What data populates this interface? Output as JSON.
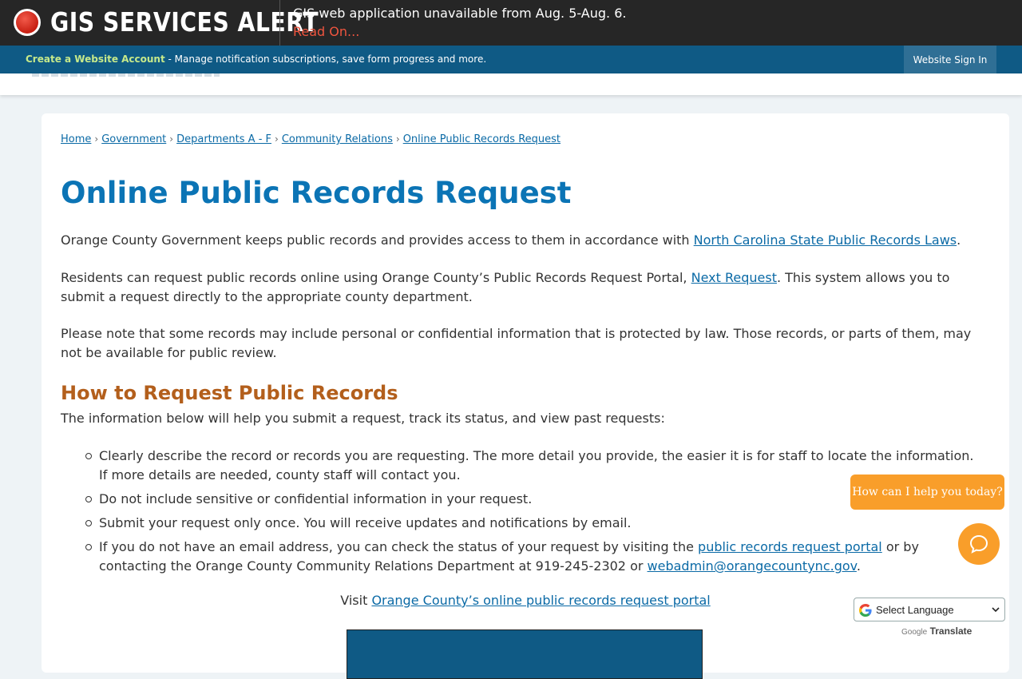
{
  "alert": {
    "title": "GIS SERVICES ALERT",
    "message": "GIS web application unavailable from Aug. 5-Aug. 6.",
    "link": "Read On..."
  },
  "account": {
    "create_link": "Create a Website Account",
    "description": " - Manage notification subscriptions, save form progress and more.",
    "sign_in": "Website Sign In"
  },
  "breadcrumb": {
    "items": [
      "Home",
      "Government",
      "Departments A - F",
      "Community Relations",
      "Online Public Records Request"
    ],
    "separator": "›"
  },
  "page": {
    "title": "Online Public Records Request",
    "p1_text": "Orange County Government keeps public records and provides access to them in accordance with ",
    "p1_link": "North Carolina State Public Records Laws",
    "p1_end": ".",
    "p2_text": "Residents can request public records online using Orange County’s Public Records Request Portal, ",
    "p2_link": "Next Request",
    "p2_end": ". This system allows you to submit a request directly to the appropriate county department.",
    "p3_text": "Please note that some records may include personal or confidential information that is protected by law. Those records, or parts of them, may not be available for public review.",
    "section_title": "How to Request Public Records",
    "p4_text": "The information below will help you submit a request, track its status, and view past requests:",
    "bullets": {
      "b1": "Clearly describe the record or records you are requesting. The more detail you provide, the easier it is for staff to locate the information. If more details are needed, county staff will contact you.",
      "b2": "Do not include sensitive or confidential information in your request.",
      "b3": "Submit your request only once. You will receive updates and notifications by email.",
      "b4_text": "If you do not have an email address, you can check the status of your request by visiting the ",
      "b4_link": "public records request portal",
      "b4_mid": " or by contacting the Orange County Community Relations Department at 919-245-2302 or ",
      "b4_email": "webadmin@orangecountync.gov",
      "b4_end": "."
    },
    "visit_text": "Visit ",
    "visit_link": "Orange County’s online public records request portal"
  },
  "chat": {
    "prompt": "How can I help you today?",
    "icon": "chat-bubble-icon"
  },
  "translate": {
    "select_label": "Select Language",
    "powered_google": "Google",
    "powered_translate": "Translate"
  },
  "colors": {
    "alert_bg": "#262626",
    "account_bar": "#0f5a85",
    "title_blue": "#0b74b5",
    "section_orange": "#b35f1c",
    "link": "#0b6aa6",
    "chat_orange": "#f99e2a"
  }
}
